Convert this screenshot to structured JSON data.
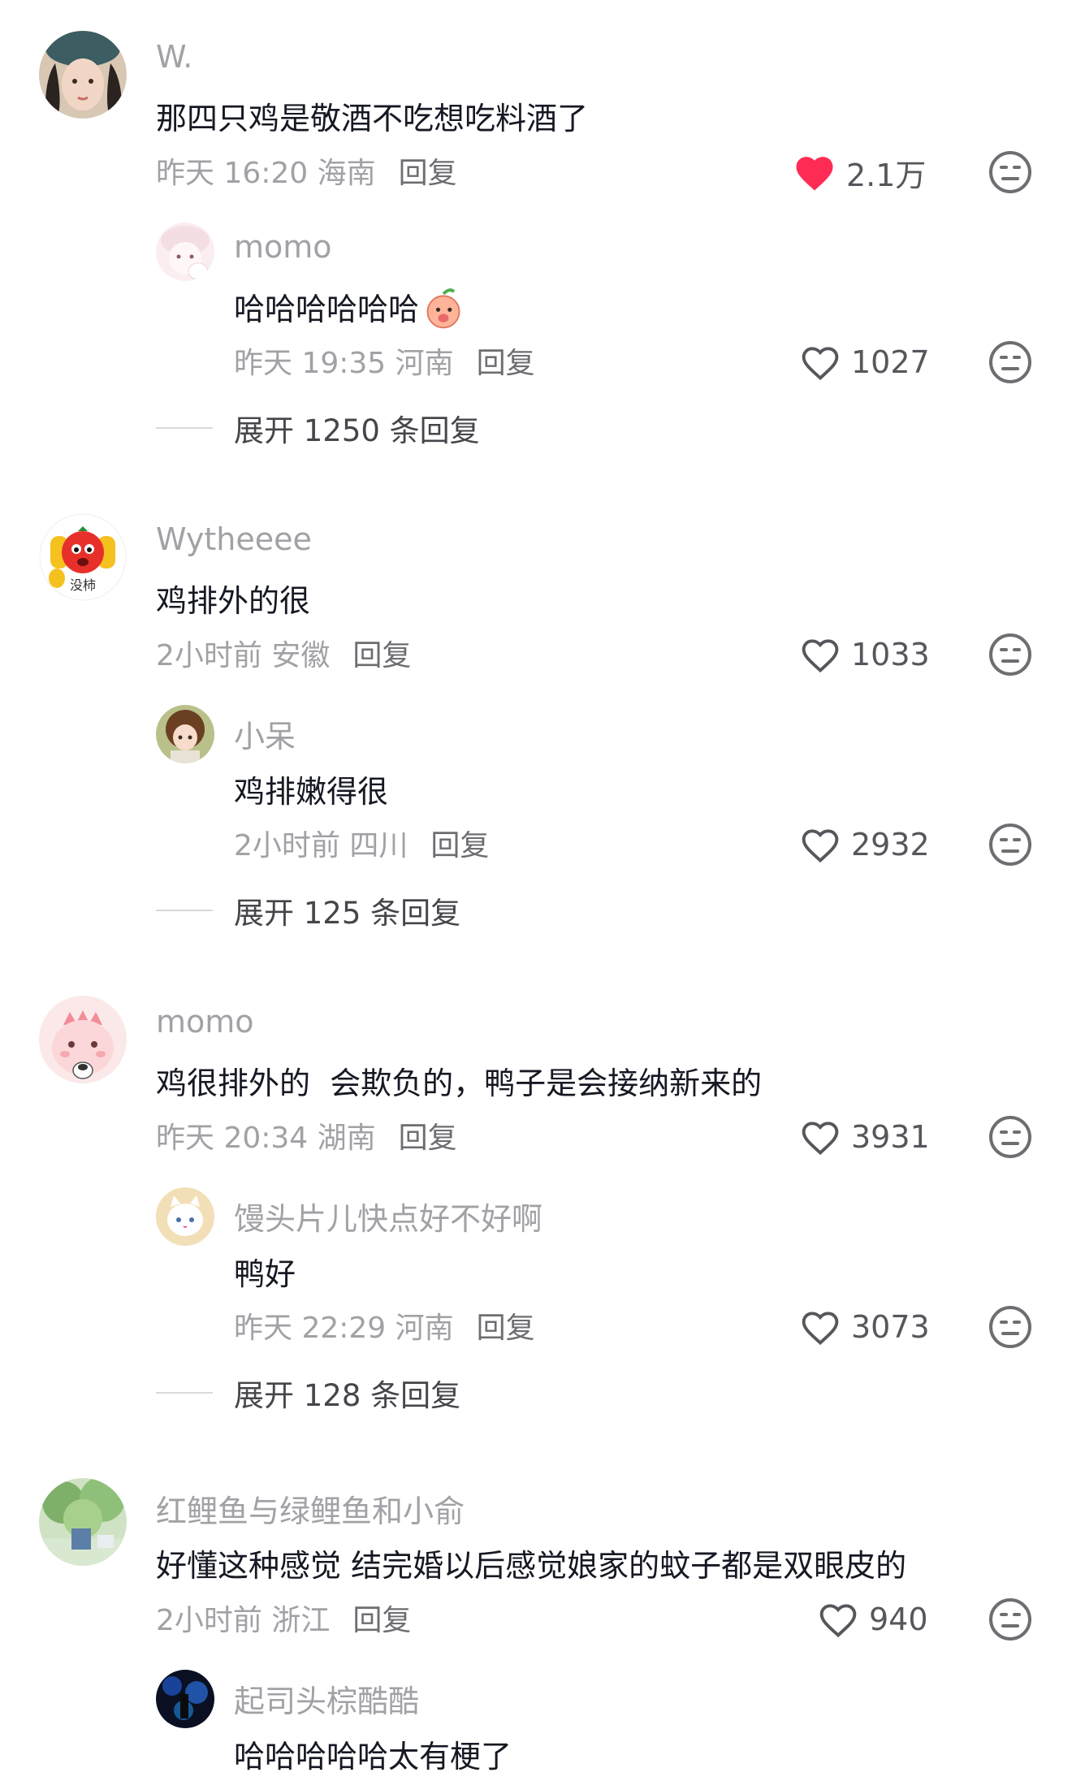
{
  "comments": [
    {
      "username": "W.",
      "text": "那四只鸡是敬酒不吃想吃料酒了",
      "time_location": "昨天 16:20 海南",
      "reply_label": "回复",
      "likes": "2.1万",
      "liked": true,
      "reply": {
        "username": "momo",
        "text": "哈哈哈哈哈哈",
        "time_location": "昨天 19:35 河南",
        "reply_label": "回复",
        "likes": "1027"
      },
      "expand_label": "展开 1250 条回复"
    },
    {
      "username": "Wytheeee",
      "text": "鸡排外的很",
      "time_location": "2小时前 安徽",
      "reply_label": "回复",
      "likes": "1033",
      "liked": false,
      "avatar_text": "没柿",
      "reply": {
        "username": "小呆",
        "text": "鸡排嫩得很",
        "time_location": "2小时前 四川",
        "reply_label": "回复",
        "likes": "2932"
      },
      "expand_label": "展开 125 条回复"
    },
    {
      "username": "momo",
      "text": "鸡很排外的  会欺负的，鸭子是会接纳新来的",
      "time_location": "昨天 20:34 湖南",
      "reply_label": "回复",
      "likes": "3931",
      "liked": false,
      "reply": {
        "username": "馒头片儿快点好不好啊",
        "text": "鸭好",
        "time_location": "昨天 22:29 河南",
        "reply_label": "回复",
        "likes": "3073"
      },
      "expand_label": "展开 128 条回复"
    },
    {
      "username": "红鲤鱼与绿鲤鱼和小俞",
      "text": "好懂这种感觉 结完婚以后感觉娘家的蚊子都是双眼皮的",
      "time_location": "2小时前 浙江",
      "reply_label": "回复",
      "likes": "940",
      "liked": false,
      "reply": {
        "username": "起司头棕酷酷",
        "text": "哈哈哈哈哈太有梗了"
      }
    }
  ],
  "colors": {
    "liked_heart": "#fe2c55",
    "secondary_text": "#a1a1a6",
    "primary_text": "#161823"
  },
  "icons": [
    "heart-icon",
    "heart-filled-icon",
    "dislike-face-icon",
    "peach-emoji-icon"
  ]
}
